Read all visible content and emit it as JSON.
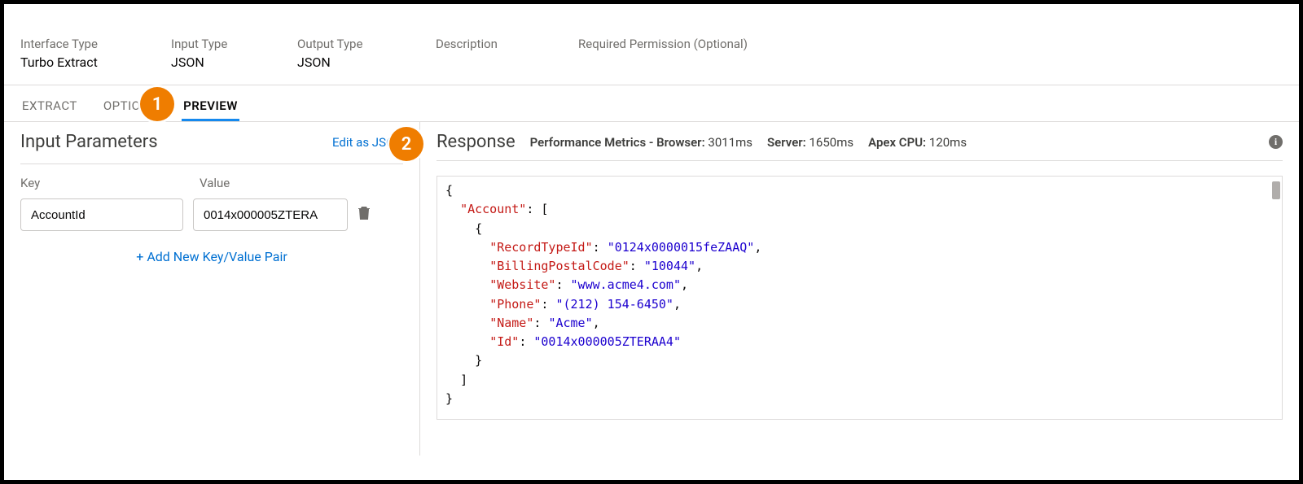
{
  "details": {
    "interfaceType": {
      "label": "Interface Type",
      "value": "Turbo Extract"
    },
    "inputType": {
      "label": "Input Type",
      "value": "JSON"
    },
    "outputType": {
      "label": "Output Type",
      "value": "JSON"
    },
    "description": {
      "label": "Description",
      "value": ""
    },
    "requiredPermission": {
      "label": "Required Permission (Optional)",
      "value": ""
    }
  },
  "tabs": {
    "extract": "EXTRACT",
    "options": "OPTIONS",
    "preview": "PREVIEW",
    "active": "preview"
  },
  "leftPane": {
    "title": "Input Parameters",
    "editJsonLabel": "Edit as JSON",
    "columns": {
      "key": "Key",
      "value": "Value"
    },
    "rows": [
      {
        "key": "AccountId",
        "value": "0014x000005ZTERA"
      }
    ],
    "addPairLabel": "Add New Key/Value Pair"
  },
  "rightPane": {
    "title": "Response",
    "metrics": {
      "prefix": "Performance Metrics - ",
      "browserLabel": "Browser:",
      "browserValue": "3011ms",
      "serverLabel": "Server:",
      "serverValue": "1650ms",
      "apexLabel": "Apex CPU:",
      "apexValue": "120ms"
    },
    "responseJson": {
      "Account": [
        {
          "RecordTypeId": "0124x0000015feZAAQ",
          "BillingPostalCode": "10044",
          "Website": "www.acme4.com",
          "Phone": "(212) 154-6450",
          "Name": "Acme",
          "Id": "0014x000005ZTERAA4"
        }
      ]
    }
  },
  "callouts": {
    "one": "1",
    "two": "2"
  }
}
